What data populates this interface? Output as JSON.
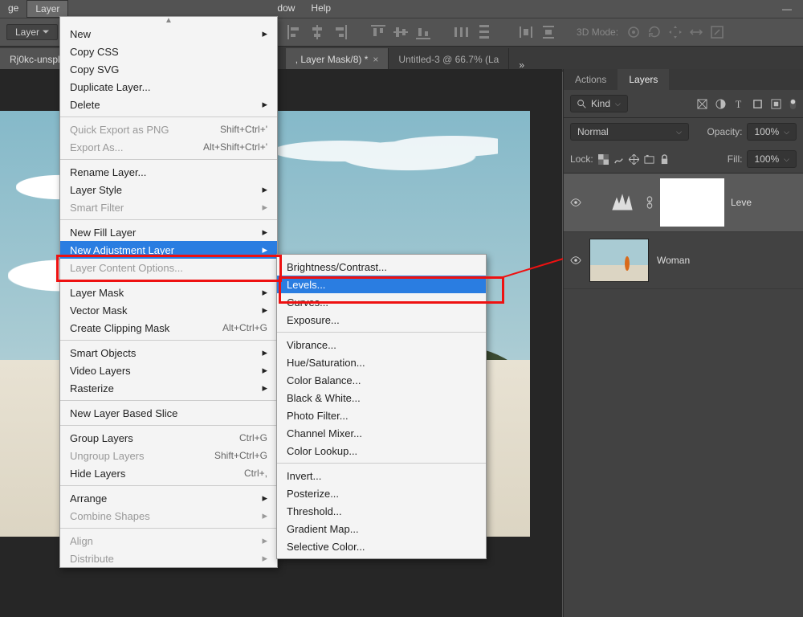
{
  "menubar": {
    "items": [
      "ge",
      "Layer",
      "dow",
      "Help"
    ]
  },
  "optionbar": {
    "layer_label": "Layer",
    "mode_label": "3D Mode:"
  },
  "tabs": {
    "tab1": "Rj0kc-unspl",
    "tab2": ", Layer Mask/8) *",
    "tab3": "Untitled-3 @ 66.7% (La"
  },
  "layer_menu": [
    {
      "t": "New",
      "sub": true
    },
    {
      "t": "Copy CSS"
    },
    {
      "t": "Copy SVG"
    },
    {
      "t": "Duplicate Layer..."
    },
    {
      "t": "Delete",
      "sub": true
    },
    {
      "hr": true
    },
    {
      "t": "Quick Export as PNG",
      "sc": "Shift+Ctrl+'",
      "dis": true
    },
    {
      "t": "Export As...",
      "sc": "Alt+Shift+Ctrl+'",
      "dis": true
    },
    {
      "hr": true
    },
    {
      "t": "Rename Layer..."
    },
    {
      "t": "Layer Style",
      "sub": true
    },
    {
      "t": "Smart Filter",
      "sub": true,
      "dis": true
    },
    {
      "hr": true
    },
    {
      "t": "New Fill Layer",
      "sub": true
    },
    {
      "t": "New Adjustment Layer",
      "sub": true,
      "sel": true
    },
    {
      "t": "Layer Content Options...",
      "dis": true
    },
    {
      "hr": true
    },
    {
      "t": "Layer Mask",
      "sub": true
    },
    {
      "t": "Vector Mask",
      "sub": true
    },
    {
      "t": "Create Clipping Mask",
      "sc": "Alt+Ctrl+G"
    },
    {
      "hr": true
    },
    {
      "t": "Smart Objects",
      "sub": true
    },
    {
      "t": "Video Layers",
      "sub": true
    },
    {
      "t": "Rasterize",
      "sub": true
    },
    {
      "hr": true
    },
    {
      "t": "New Layer Based Slice"
    },
    {
      "hr": true
    },
    {
      "t": "Group Layers",
      "sc": "Ctrl+G"
    },
    {
      "t": "Ungroup Layers",
      "sc": "Shift+Ctrl+G",
      "dis": true
    },
    {
      "t": "Hide Layers",
      "sc": "Ctrl+,"
    },
    {
      "hr": true
    },
    {
      "t": "Arrange",
      "sub": true
    },
    {
      "t": "Combine Shapes",
      "sub": true,
      "dis": true
    },
    {
      "hr": true
    },
    {
      "t": "Align",
      "sub": true,
      "dis": true
    },
    {
      "t": "Distribute",
      "sub": true,
      "dis": true
    }
  ],
  "adj_submenu": [
    {
      "t": "Brightness/Contrast..."
    },
    {
      "t": "Levels...",
      "sel": true
    },
    {
      "t": "Curves..."
    },
    {
      "t": "Exposure..."
    },
    {
      "hr": true
    },
    {
      "t": "Vibrance..."
    },
    {
      "t": "Hue/Saturation..."
    },
    {
      "t": "Color Balance..."
    },
    {
      "t": "Black & White..."
    },
    {
      "t": "Photo Filter..."
    },
    {
      "t": "Channel Mixer..."
    },
    {
      "t": "Color Lookup..."
    },
    {
      "hr": true
    },
    {
      "t": "Invert..."
    },
    {
      "t": "Posterize..."
    },
    {
      "t": "Threshold..."
    },
    {
      "t": "Gradient Map..."
    },
    {
      "t": "Selective Color..."
    }
  ],
  "panel": {
    "tab_actions": "Actions",
    "tab_layers": "Layers",
    "kind": "Kind",
    "blend": "Normal",
    "opacity_label": "Opacity:",
    "opacity_value": "100%",
    "lock_label": "Lock:",
    "fill_label": "Fill:",
    "fill_value": "100%",
    "layer1_name": "Leve",
    "layer2_name": "Woman"
  }
}
